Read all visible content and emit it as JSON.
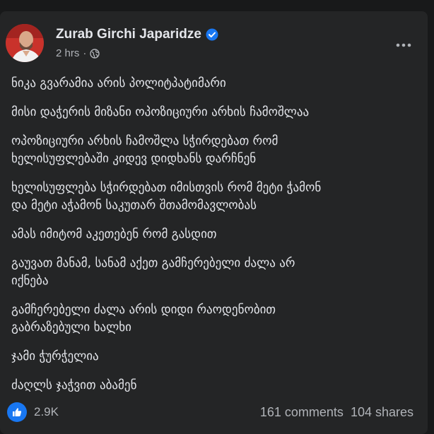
{
  "post": {
    "author_name": "Zurab Girchi Japaridze",
    "timestamp": "2 hrs",
    "privacy_icon": "globe-icon",
    "verified_icon": "verified-badge-icon",
    "more_icon": "more-options-icon",
    "paragraphs": [
      "ნიკა გვარამია არის პოლიტპატიმარი",
      "მისი დაჭერის მიზანი ოპოზიციური არხის ჩამოშლაა",
      "ოპოზიციური არხის ჩამოშლა სჭირდებათ რომ\nხელისუფლებაში კიდევ დიდხანს დარჩნენ",
      "ხელისუფლება სჭირდებათ იმისთვის რომ მეტი ჭამონ\nდა მეტი აჭამონ საკუთარ შთამომავლობას",
      "ამას იმიტომ აკეთებენ რომ გასდით",
      "გაუვათ მანამ, სანამ აქეთ გამჩერებელი ძალა არ\nიქნება",
      "გამჩერებელი ძალა არის დიდი რაოდენობით\nგაბრაზებული ხალხი",
      "ჯამი ჭურჭელია",
      "ძაღლს ჯაჭვით აბამენ"
    ],
    "reaction_icon": "thumbs-up-icon",
    "reaction_count": "2.9K",
    "comments_label": "161 comments",
    "shares_label": "104 shares"
  },
  "colors": {
    "page_bg": "#18191a",
    "card_bg": "#242526",
    "primary_text": "#e4e6eb",
    "secondary_text": "#b0b3b8",
    "accent": "#1877f2"
  }
}
